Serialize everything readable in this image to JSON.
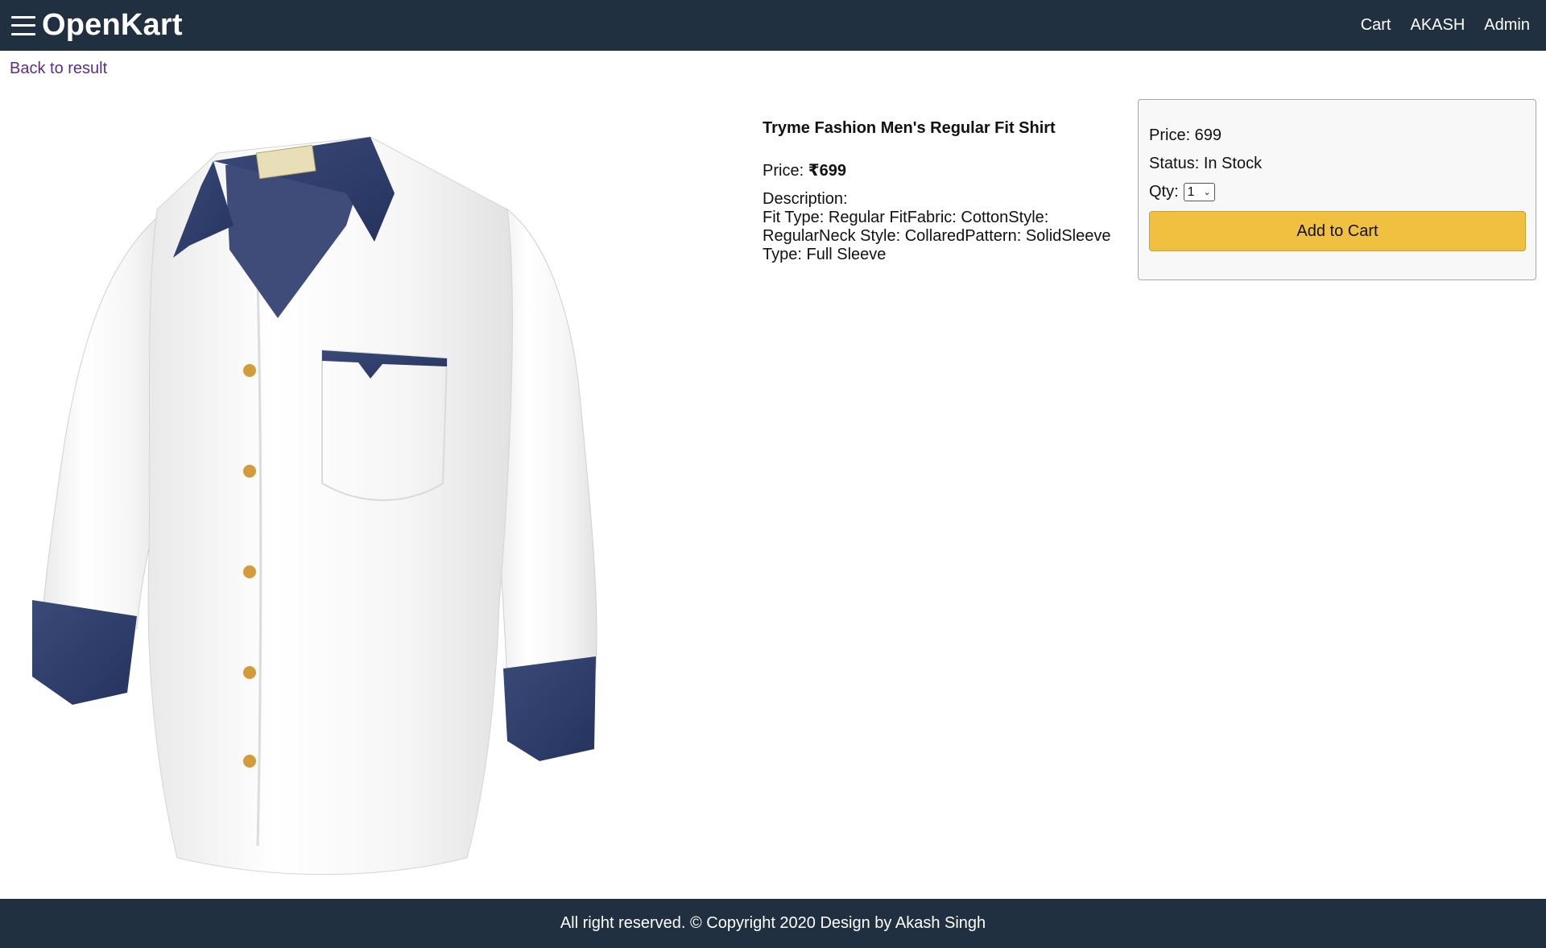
{
  "header": {
    "brand": "OpenKart",
    "nav": {
      "cart": "Cart",
      "user": "AKASH",
      "admin": "Admin"
    },
    "icon": "hamburger-menu-icon"
  },
  "back_link": "Back to result",
  "product": {
    "name": "Tryme Fashion Men's Regular Fit Shirt",
    "price_label": "Price:",
    "price_value": "₹699",
    "description_label": "Description:",
    "description_text": "Fit Type: Regular FitFabric: CottonStyle: RegularNeck Style: CollaredPattern: SolidSleeve Type: Full Sleeve",
    "image_alt": "white shirt with denim collar and cuffs"
  },
  "card": {
    "price": "Price: 699",
    "status": "Status: In Stock",
    "qty_label": "Qty:",
    "qty_value": "1",
    "add_to_cart": "Add to Cart"
  },
  "footer": {
    "text": "All right reserved. © Copyright 2020 Design by Akash Singh"
  },
  "colors": {
    "header_bg": "#203040",
    "button_bg": "#f0c040",
    "link": "#5a2f8c"
  }
}
